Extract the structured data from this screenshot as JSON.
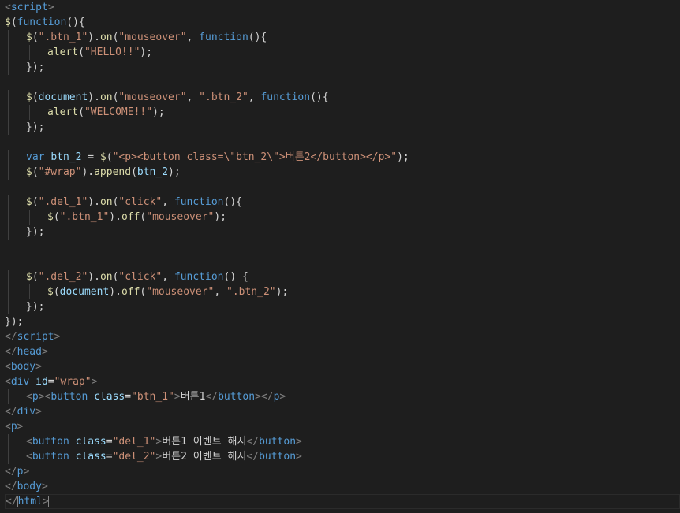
{
  "colors": {
    "background": "#1e1e1e",
    "tag": "#569cd6",
    "attribute": "#9cdcfe",
    "string": "#ce9178",
    "function": "#dcdcaa",
    "keyword": "#569cd6",
    "text": "#d4d4d4",
    "punctuation": "#808080",
    "indent_guide": "#404040"
  },
  "editor": {
    "language": "html",
    "lines": [
      {
        "indent": 0,
        "tokens": [
          {
            "t": "<",
            "c": "punctuation"
          },
          {
            "t": "script",
            "c": "tag"
          },
          {
            "t": ">",
            "c": "punctuation"
          }
        ]
      },
      {
        "indent": 0,
        "tokens": [
          {
            "t": "$",
            "c": "function"
          },
          {
            "t": "(",
            "c": "text"
          },
          {
            "t": "function",
            "c": "keyword"
          },
          {
            "t": "(){",
            "c": "text"
          }
        ]
      },
      {
        "indent": 1,
        "tokens": [
          {
            "t": "$",
            "c": "function"
          },
          {
            "t": "(",
            "c": "text"
          },
          {
            "t": "\".btn_1\"",
            "c": "string"
          },
          {
            "t": ").",
            "c": "text"
          },
          {
            "t": "on",
            "c": "function"
          },
          {
            "t": "(",
            "c": "text"
          },
          {
            "t": "\"mouseover\"",
            "c": "string"
          },
          {
            "t": ", ",
            "c": "text"
          },
          {
            "t": "function",
            "c": "keyword"
          },
          {
            "t": "(){",
            "c": "text"
          }
        ]
      },
      {
        "indent": 2,
        "tokens": [
          {
            "t": "alert",
            "c": "function"
          },
          {
            "t": "(",
            "c": "text"
          },
          {
            "t": "\"HELLO!!\"",
            "c": "string"
          },
          {
            "t": ");",
            "c": "text"
          }
        ]
      },
      {
        "indent": 1,
        "tokens": [
          {
            "t": "});",
            "c": "text"
          }
        ]
      },
      {
        "indent": 0,
        "tokens": []
      },
      {
        "indent": 1,
        "tokens": [
          {
            "t": "$",
            "c": "function"
          },
          {
            "t": "(",
            "c": "text"
          },
          {
            "t": "document",
            "c": "attribute"
          },
          {
            "t": ").",
            "c": "text"
          },
          {
            "t": "on",
            "c": "function"
          },
          {
            "t": "(",
            "c": "text"
          },
          {
            "t": "\"mouseover\"",
            "c": "string"
          },
          {
            "t": ", ",
            "c": "text"
          },
          {
            "t": "\".btn_2\"",
            "c": "string"
          },
          {
            "t": ", ",
            "c": "text"
          },
          {
            "t": "function",
            "c": "keyword"
          },
          {
            "t": "(){",
            "c": "text"
          }
        ]
      },
      {
        "indent": 2,
        "tokens": [
          {
            "t": "alert",
            "c": "function"
          },
          {
            "t": "(",
            "c": "text"
          },
          {
            "t": "\"WELCOME!!\"",
            "c": "string"
          },
          {
            "t": ");",
            "c": "text"
          }
        ]
      },
      {
        "indent": 1,
        "tokens": [
          {
            "t": "});",
            "c": "text"
          }
        ]
      },
      {
        "indent": 0,
        "tokens": []
      },
      {
        "indent": 1,
        "tokens": [
          {
            "t": "var",
            "c": "keyword"
          },
          {
            "t": " ",
            "c": "text"
          },
          {
            "t": "btn_2",
            "c": "attribute"
          },
          {
            "t": " = ",
            "c": "text"
          },
          {
            "t": "$",
            "c": "function"
          },
          {
            "t": "(",
            "c": "text"
          },
          {
            "t": "\"<p><button class=\\\"btn_2\\\">버튼2</button></p>\"",
            "c": "string"
          },
          {
            "t": ");",
            "c": "text"
          }
        ]
      },
      {
        "indent": 1,
        "tokens": [
          {
            "t": "$",
            "c": "function"
          },
          {
            "t": "(",
            "c": "text"
          },
          {
            "t": "\"#wrap\"",
            "c": "string"
          },
          {
            "t": ").",
            "c": "text"
          },
          {
            "t": "append",
            "c": "function"
          },
          {
            "t": "(",
            "c": "text"
          },
          {
            "t": "btn_2",
            "c": "attribute"
          },
          {
            "t": ");",
            "c": "text"
          }
        ]
      },
      {
        "indent": 0,
        "tokens": []
      },
      {
        "indent": 1,
        "tokens": [
          {
            "t": "$",
            "c": "function"
          },
          {
            "t": "(",
            "c": "text"
          },
          {
            "t": "\".del_1\"",
            "c": "string"
          },
          {
            "t": ").",
            "c": "text"
          },
          {
            "t": "on",
            "c": "function"
          },
          {
            "t": "(",
            "c": "text"
          },
          {
            "t": "\"click\"",
            "c": "string"
          },
          {
            "t": ", ",
            "c": "text"
          },
          {
            "t": "function",
            "c": "keyword"
          },
          {
            "t": "(){",
            "c": "text"
          }
        ]
      },
      {
        "indent": 2,
        "tokens": [
          {
            "t": "$",
            "c": "function"
          },
          {
            "t": "(",
            "c": "text"
          },
          {
            "t": "\".btn_1\"",
            "c": "string"
          },
          {
            "t": ").",
            "c": "text"
          },
          {
            "t": "off",
            "c": "function"
          },
          {
            "t": "(",
            "c": "text"
          },
          {
            "t": "\"mouseover\"",
            "c": "string"
          },
          {
            "t": ");",
            "c": "text"
          }
        ]
      },
      {
        "indent": 1,
        "tokens": [
          {
            "t": "});",
            "c": "text"
          }
        ]
      },
      {
        "indent": 0,
        "tokens": []
      },
      {
        "indent": 0,
        "tokens": []
      },
      {
        "indent": 1,
        "tokens": [
          {
            "t": "$",
            "c": "function"
          },
          {
            "t": "(",
            "c": "text"
          },
          {
            "t": "\".del_2\"",
            "c": "string"
          },
          {
            "t": ").",
            "c": "text"
          },
          {
            "t": "on",
            "c": "function"
          },
          {
            "t": "(",
            "c": "text"
          },
          {
            "t": "\"click\"",
            "c": "string"
          },
          {
            "t": ", ",
            "c": "text"
          },
          {
            "t": "function",
            "c": "keyword"
          },
          {
            "t": "() {",
            "c": "text"
          }
        ]
      },
      {
        "indent": 2,
        "tokens": [
          {
            "t": "$",
            "c": "function"
          },
          {
            "t": "(",
            "c": "text"
          },
          {
            "t": "document",
            "c": "attribute"
          },
          {
            "t": ").",
            "c": "text"
          },
          {
            "t": "off",
            "c": "function"
          },
          {
            "t": "(",
            "c": "text"
          },
          {
            "t": "\"mouseover\"",
            "c": "string"
          },
          {
            "t": ", ",
            "c": "text"
          },
          {
            "t": "\".btn_2\"",
            "c": "string"
          },
          {
            "t": ");",
            "c": "text"
          }
        ]
      },
      {
        "indent": 1,
        "tokens": [
          {
            "t": "});",
            "c": "text"
          }
        ]
      },
      {
        "indent": 0,
        "tokens": [
          {
            "t": "});",
            "c": "text"
          }
        ]
      },
      {
        "indent": 0,
        "tokens": [
          {
            "t": "</",
            "c": "punctuation"
          },
          {
            "t": "script",
            "c": "tag"
          },
          {
            "t": ">",
            "c": "punctuation"
          }
        ]
      },
      {
        "indent": 0,
        "tokens": [
          {
            "t": "</",
            "c": "punctuation"
          },
          {
            "t": "head",
            "c": "tag"
          },
          {
            "t": ">",
            "c": "punctuation"
          }
        ]
      },
      {
        "indent": 0,
        "tokens": [
          {
            "t": "<",
            "c": "punctuation"
          },
          {
            "t": "body",
            "c": "tag"
          },
          {
            "t": ">",
            "c": "punctuation"
          }
        ]
      },
      {
        "indent": 0,
        "tokens": [
          {
            "t": "<",
            "c": "punctuation"
          },
          {
            "t": "div",
            "c": "tag"
          },
          {
            "t": " ",
            "c": "text"
          },
          {
            "t": "id",
            "c": "attribute"
          },
          {
            "t": "=",
            "c": "text"
          },
          {
            "t": "\"wrap\"",
            "c": "string"
          },
          {
            "t": ">",
            "c": "punctuation"
          }
        ]
      },
      {
        "indent": 1,
        "tokens": [
          {
            "t": "<",
            "c": "punctuation"
          },
          {
            "t": "p",
            "c": "tag"
          },
          {
            "t": "><",
            "c": "punctuation"
          },
          {
            "t": "button",
            "c": "tag"
          },
          {
            "t": " ",
            "c": "text"
          },
          {
            "t": "class",
            "c": "attribute"
          },
          {
            "t": "=",
            "c": "text"
          },
          {
            "t": "\"btn_1\"",
            "c": "string"
          },
          {
            "t": ">",
            "c": "punctuation"
          },
          {
            "t": "버튼1",
            "c": "text"
          },
          {
            "t": "</",
            "c": "punctuation"
          },
          {
            "t": "button",
            "c": "tag"
          },
          {
            "t": "></",
            "c": "punctuation"
          },
          {
            "t": "p",
            "c": "tag"
          },
          {
            "t": ">",
            "c": "punctuation"
          }
        ]
      },
      {
        "indent": 0,
        "tokens": [
          {
            "t": "</",
            "c": "punctuation"
          },
          {
            "t": "div",
            "c": "tag"
          },
          {
            "t": ">",
            "c": "punctuation"
          }
        ]
      },
      {
        "indent": 0,
        "tokens": [
          {
            "t": "<",
            "c": "punctuation"
          },
          {
            "t": "p",
            "c": "tag"
          },
          {
            "t": ">",
            "c": "punctuation"
          }
        ]
      },
      {
        "indent": 1,
        "tokens": [
          {
            "t": "<",
            "c": "punctuation"
          },
          {
            "t": "button",
            "c": "tag"
          },
          {
            "t": " ",
            "c": "text"
          },
          {
            "t": "class",
            "c": "attribute"
          },
          {
            "t": "=",
            "c": "text"
          },
          {
            "t": "\"del_1\"",
            "c": "string"
          },
          {
            "t": ">",
            "c": "punctuation"
          },
          {
            "t": "버튼1 이벤트 해지",
            "c": "text"
          },
          {
            "t": "</",
            "c": "punctuation"
          },
          {
            "t": "button",
            "c": "tag"
          },
          {
            "t": ">",
            "c": "punctuation"
          }
        ]
      },
      {
        "indent": 1,
        "tokens": [
          {
            "t": "<",
            "c": "punctuation"
          },
          {
            "t": "button",
            "c": "tag"
          },
          {
            "t": " ",
            "c": "text"
          },
          {
            "t": "class",
            "c": "attribute"
          },
          {
            "t": "=",
            "c": "text"
          },
          {
            "t": "\"del_2\"",
            "c": "string"
          },
          {
            "t": ">",
            "c": "punctuation"
          },
          {
            "t": "버튼2 이벤트 해지",
            "c": "text"
          },
          {
            "t": "</",
            "c": "punctuation"
          },
          {
            "t": "button",
            "c": "tag"
          },
          {
            "t": ">",
            "c": "punctuation"
          }
        ]
      },
      {
        "indent": 0,
        "tokens": [
          {
            "t": "</",
            "c": "punctuation"
          },
          {
            "t": "p",
            "c": "tag"
          },
          {
            "t": ">",
            "c": "punctuation"
          }
        ]
      },
      {
        "indent": 0,
        "tokens": [
          {
            "t": "</",
            "c": "punctuation"
          },
          {
            "t": "body",
            "c": "tag"
          },
          {
            "t": ">",
            "c": "punctuation"
          }
        ]
      },
      {
        "indent": 0,
        "current": true,
        "cursor_before": true,
        "tokens": [
          {
            "t": "</",
            "c": "punctuation",
            "match": true
          },
          {
            "t": "html",
            "c": "tag"
          },
          {
            "t": ">",
            "c": "punctuation",
            "match": true
          }
        ]
      }
    ]
  }
}
